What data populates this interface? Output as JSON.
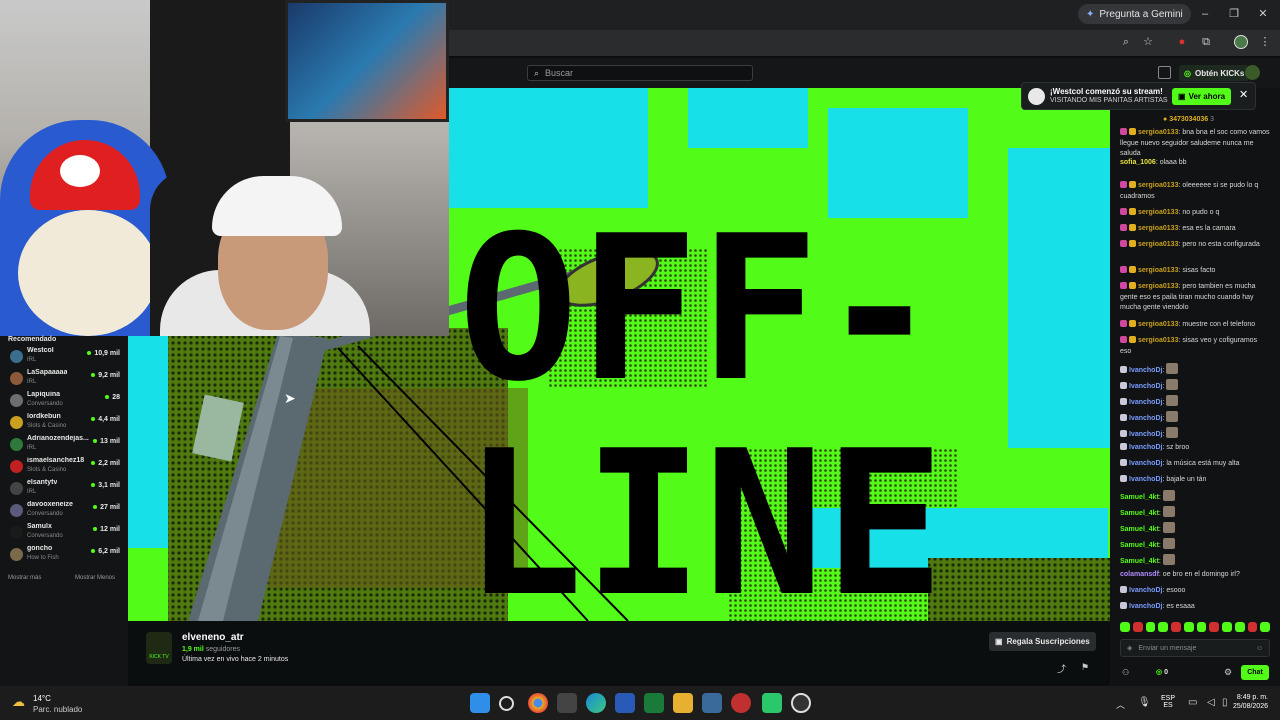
{
  "browser": {
    "gemini_label": "Pregunta a Gemini",
    "window_buttons": [
      "–",
      "❐",
      "✕"
    ]
  },
  "header": {
    "search_placeholder": "Buscar",
    "kicks_button": "Obtén KICKs"
  },
  "sidebar": {
    "title": "Recomendado",
    "items": [
      {
        "name": "Westcol",
        "category": "IRL",
        "viewers": "10,9 mil",
        "color": "#3a6e8c"
      },
      {
        "name": "LaSapaaaaa",
        "category": "IRL",
        "viewers": "9,2 mil",
        "color": "#8c5a3a"
      },
      {
        "name": "Lapiquina",
        "category": "Conversando",
        "viewers": "28",
        "color": "#6e6e6e"
      },
      {
        "name": "lordkebun",
        "category": "Slots & Casino",
        "viewers": "4,4 mil",
        "color": "#c9a020"
      },
      {
        "name": "Adrianozendejas...",
        "category": "IRL",
        "viewers": "13 mil",
        "color": "#2e7a3a"
      },
      {
        "name": "ismaelsanchez18",
        "category": "Slots & Casino",
        "viewers": "2,2 mil",
        "color": "#c02020"
      },
      {
        "name": "elsantytv",
        "category": "IRL",
        "viewers": "3,1 mil",
        "color": "#444444"
      },
      {
        "name": "davooxeneize",
        "category": "Conversando",
        "viewers": "27 mil",
        "color": "#5a5a7a"
      },
      {
        "name": "Samulx",
        "category": "Conversando",
        "viewers": "12 mil",
        "color": "#1a1a1a"
      },
      {
        "name": "goncho",
        "category": "How to Fish",
        "viewers": "6,2 mil",
        "color": "#7a6a4a"
      }
    ],
    "show_more": "Mostrar más",
    "show_less": "Mostrar Menos"
  },
  "player": {
    "offline_line1": "OFF-",
    "offline_line2": "LINE"
  },
  "channel": {
    "name": "elveneno_atr",
    "followers_count": "1,9 mil",
    "followers_label": "seguidores",
    "last_live": "Última vez en vivo hace 2 minutos",
    "gift_button": "Regala Suscripciones",
    "avatar_text": "KICK TV"
  },
  "notification": {
    "title": "¡Westcol comenzó su stream!",
    "subtitle": "VISITANDO MIS PANITAS ARTISTAS",
    "button": "Ver ahora"
  },
  "chat": {
    "pinned_number": "3473034036",
    "pinned_count": "3",
    "messages": [
      {
        "user": "sergioa0133",
        "color": "#c9a020",
        "text": "bna bna el soc como vamos llegue nuevo seguidor saludeme nunca me saluda",
        "badges": 2
      },
      {
        "user": "sofia_1006",
        "color": "#e8e040",
        "text": "olaaa bb",
        "badges": 0
      },
      {
        "user": "sergioa0133",
        "color": "#c9a020",
        "text": "oleeeeee si se pudo lo q cuadramos",
        "badges": 2
      },
      {
        "user": "sergioa0133",
        "color": "#c9a020",
        "text": "no pudo o q",
        "badges": 2
      },
      {
        "user": "sergioa0133",
        "color": "#c9a020",
        "text": "esa es la camara",
        "badges": 2
      },
      {
        "user": "sergioa0133",
        "color": "#c9a020",
        "text": "pero no esta configurada",
        "badges": 2
      },
      {
        "user": "sergioa0133",
        "color": "#c9a020",
        "text": "sisas facto",
        "badges": 2
      },
      {
        "user": "sergioa0133",
        "color": "#c9a020",
        "text": "pero tambien es mucha gente eso es paila tiran mucho cuando hay mucha gente viendolo",
        "badges": 2
      },
      {
        "user": "sergioa0133",
        "color": "#c9a020",
        "text": "muestre con el telefono",
        "badges": 2
      },
      {
        "user": "sergioa0133",
        "color": "#c9a020",
        "text": "sisas veo y cofiguramos eso",
        "badges": 2
      },
      {
        "user": "IvanchoDj",
        "color": "#7a9cff",
        "text": "",
        "badges": 1,
        "emote": true
      },
      {
        "user": "IvanchoDj",
        "color": "#7a9cff",
        "text": "",
        "badges": 1,
        "emote": true
      },
      {
        "user": "IvanchoDj",
        "color": "#7a9cff",
        "text": "",
        "badges": 1,
        "emote": true
      },
      {
        "user": "IvanchoDj",
        "color": "#7a9cff",
        "text": "",
        "badges": 1,
        "emote": true
      },
      {
        "user": "IvanchoDj",
        "color": "#7a9cff",
        "text": "",
        "badges": 1,
        "emote": true
      },
      {
        "user": "IvanchoDj",
        "color": "#7a9cff",
        "text": "sz broo",
        "badges": 1
      },
      {
        "user": "IvanchoDj",
        "color": "#7a9cff",
        "text": "la música está muy alta",
        "badges": 1
      },
      {
        "user": "IvanchoDj",
        "color": "#7a9cff",
        "text": "bajale un tán",
        "badges": 1
      },
      {
        "user": "Samuel_4kt",
        "color": "#53fc18",
        "text": "",
        "badges": 0,
        "emote": true
      },
      {
        "user": "Samuel_4kt",
        "color": "#53fc18",
        "text": "",
        "badges": 0,
        "emote": true
      },
      {
        "user": "Samuel_4kt",
        "color": "#53fc18",
        "text": "",
        "badges": 0,
        "emote": true
      },
      {
        "user": "Samuel_4kt",
        "color": "#53fc18",
        "text": "",
        "badges": 0,
        "emote": true
      },
      {
        "user": "Samuel_4kt",
        "color": "#53fc18",
        "text": "",
        "badges": 0,
        "emote": true
      },
      {
        "user": "colamansdf",
        "color": "#b08cff",
        "text": "oe bro en el domingo irl?",
        "badges": 0
      },
      {
        "user": "IvanchoDj",
        "color": "#7a9cff",
        "text": "esooo",
        "badges": 1
      },
      {
        "user": "IvanchoDj",
        "color": "#7a9cff",
        "text": "es esaaa",
        "badges": 1
      }
    ],
    "input_placeholder": "Enviar un mensaje",
    "kicks_count": "0",
    "chat_button": "Chat"
  },
  "taskbar": {
    "weather_temp": "14°C",
    "weather_desc": "Parc. nublado",
    "lang_top": "ESP",
    "lang_bottom": "ES",
    "time": "8:49 p. m.",
    "date": "25/08/2026"
  }
}
